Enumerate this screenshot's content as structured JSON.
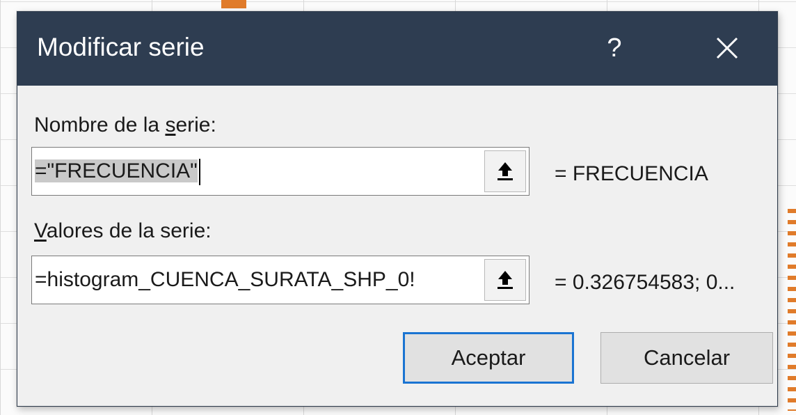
{
  "dialog": {
    "title": "Modificar serie",
    "help_label": "?",
    "close_icon": "close-icon"
  },
  "series_name": {
    "label_prefix": "Nombre de la ",
    "label_accel": "s",
    "label_suffix": "erie:",
    "value": "=\"FRECUENCIA\"",
    "collapse_icon": "range-select-icon",
    "result": "= FRECUENCIA"
  },
  "series_values": {
    "label_accel": "V",
    "label_suffix": "alores de la serie:",
    "value": "=histogram_CUENCA_SURATA_SHP_0!",
    "collapse_icon": "range-select-icon",
    "result": "= 0.326754583; 0..."
  },
  "buttons": {
    "ok": "Aceptar",
    "cancel": "Cancelar"
  },
  "colors": {
    "titlebar": "#2e3d51",
    "primary_border": "#1a74d2",
    "chart_orange": "#e07b2a"
  }
}
